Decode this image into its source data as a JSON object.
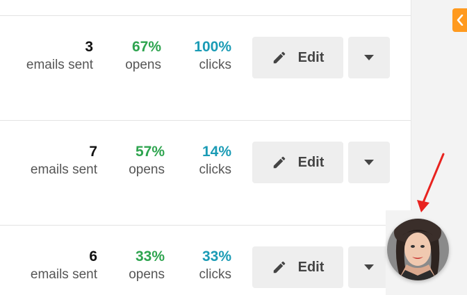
{
  "colors": {
    "opens": "#2ea44f",
    "clicks": "#1a9bb5",
    "accent": "#ff9a1f"
  },
  "icons": {
    "edit": "pencil-icon",
    "dropdown": "caret-down-icon",
    "collapse": "chevron-left-icon"
  },
  "rows": [
    {
      "sent_value": "3",
      "sent_label": "emails sent",
      "opens_value": "67%",
      "opens_label": "opens",
      "clicks_value": "100%",
      "clicks_label": "clicks",
      "edit_label": "Edit"
    },
    {
      "sent_value": "7",
      "sent_label": "emails sent",
      "opens_value": "57%",
      "opens_label": "opens",
      "clicks_value": "14%",
      "clicks_label": "clicks",
      "edit_label": "Edit"
    },
    {
      "sent_value": "6",
      "sent_label": "emails sent",
      "opens_value": "33%",
      "opens_label": "opens",
      "clicks_value": "33%",
      "clicks_label": "clicks",
      "edit_label": "Edit"
    }
  ]
}
